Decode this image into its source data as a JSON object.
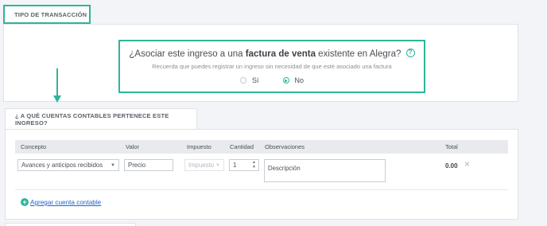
{
  "section_tabs": {
    "transaction_type": "TIPO DE TRANSACCIÓN",
    "accounts": "¿ A QUÉ CUENTAS CONTABLES PERTENECE ESTE INGRESO?"
  },
  "association": {
    "question_prefix": "¿Asociar este ingreso a una ",
    "question_bold": "factura de venta",
    "question_suffix": " existente en Alegra?",
    "help_icon": "?",
    "subtitle": "Recuerda que puedes registrar un ingreso sin necesidad de que esté asociado una factura",
    "options": [
      {
        "label": "Sí",
        "selected": false
      },
      {
        "label": "No",
        "selected": true
      }
    ]
  },
  "table": {
    "headers": {
      "concept": "Concepto",
      "value": "Valor",
      "tax": "Impuesto",
      "quantity": "Cantidad",
      "observations": "Observaciones",
      "total": "Total"
    },
    "row": {
      "concept": "Avances y anticipos recibidos",
      "value_placeholder": "Precio",
      "tax_placeholder": "Impuesto",
      "quantity": "1",
      "description_placeholder": "Descripción",
      "total": "0.00",
      "remove_icon": "×"
    }
  },
  "add_account": {
    "icon": "+",
    "label": "Agregar cuenta contable"
  },
  "colors": {
    "accent": "#2fb49a",
    "link": "#2563c7"
  }
}
